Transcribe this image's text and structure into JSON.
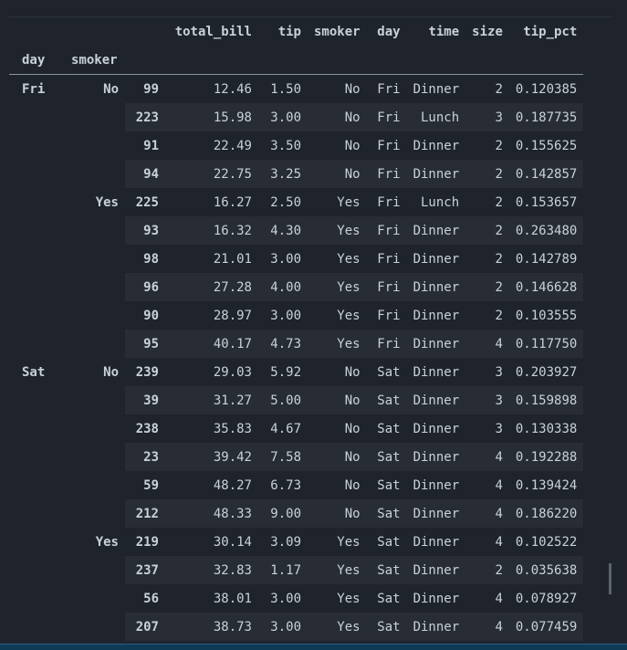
{
  "table": {
    "columns": [
      "total_bill",
      "tip",
      "smoker",
      "day",
      "time",
      "size",
      "tip_pct"
    ],
    "index_names": [
      "day",
      "smoker"
    ],
    "groups": [
      {
        "day": "Fri",
        "subgroups": [
          {
            "smoker": "No",
            "rows": [
              {
                "idx": "99",
                "total_bill": "12.46",
                "tip": "1.50",
                "smoker": "No",
                "day": "Fri",
                "time": "Dinner",
                "size": "2",
                "tip_pct": "0.120385"
              },
              {
                "idx": "223",
                "total_bill": "15.98",
                "tip": "3.00",
                "smoker": "No",
                "day": "Fri",
                "time": "Lunch",
                "size": "3",
                "tip_pct": "0.187735"
              },
              {
                "idx": "91",
                "total_bill": "22.49",
                "tip": "3.50",
                "smoker": "No",
                "day": "Fri",
                "time": "Dinner",
                "size": "2",
                "tip_pct": "0.155625"
              },
              {
                "idx": "94",
                "total_bill": "22.75",
                "tip": "3.25",
                "smoker": "No",
                "day": "Fri",
                "time": "Dinner",
                "size": "2",
                "tip_pct": "0.142857"
              }
            ]
          },
          {
            "smoker": "Yes",
            "rows": [
              {
                "idx": "225",
                "total_bill": "16.27",
                "tip": "2.50",
                "smoker": "Yes",
                "day": "Fri",
                "time": "Lunch",
                "size": "2",
                "tip_pct": "0.153657"
              },
              {
                "idx": "93",
                "total_bill": "16.32",
                "tip": "4.30",
                "smoker": "Yes",
                "day": "Fri",
                "time": "Dinner",
                "size": "2",
                "tip_pct": "0.263480"
              },
              {
                "idx": "98",
                "total_bill": "21.01",
                "tip": "3.00",
                "smoker": "Yes",
                "day": "Fri",
                "time": "Dinner",
                "size": "2",
                "tip_pct": "0.142789"
              },
              {
                "idx": "96",
                "total_bill": "27.28",
                "tip": "4.00",
                "smoker": "Yes",
                "day": "Fri",
                "time": "Dinner",
                "size": "2",
                "tip_pct": "0.146628"
              },
              {
                "idx": "90",
                "total_bill": "28.97",
                "tip": "3.00",
                "smoker": "Yes",
                "day": "Fri",
                "time": "Dinner",
                "size": "2",
                "tip_pct": "0.103555"
              },
              {
                "idx": "95",
                "total_bill": "40.17",
                "tip": "4.73",
                "smoker": "Yes",
                "day": "Fri",
                "time": "Dinner",
                "size": "4",
                "tip_pct": "0.117750"
              }
            ]
          }
        ]
      },
      {
        "day": "Sat",
        "subgroups": [
          {
            "smoker": "No",
            "rows": [
              {
                "idx": "239",
                "total_bill": "29.03",
                "tip": "5.92",
                "smoker": "No",
                "day": "Sat",
                "time": "Dinner",
                "size": "3",
                "tip_pct": "0.203927"
              },
              {
                "idx": "39",
                "total_bill": "31.27",
                "tip": "5.00",
                "smoker": "No",
                "day": "Sat",
                "time": "Dinner",
                "size": "3",
                "tip_pct": "0.159898"
              },
              {
                "idx": "238",
                "total_bill": "35.83",
                "tip": "4.67",
                "smoker": "No",
                "day": "Sat",
                "time": "Dinner",
                "size": "3",
                "tip_pct": "0.130338"
              },
              {
                "idx": "23",
                "total_bill": "39.42",
                "tip": "7.58",
                "smoker": "No",
                "day": "Sat",
                "time": "Dinner",
                "size": "4",
                "tip_pct": "0.192288"
              },
              {
                "idx": "59",
                "total_bill": "48.27",
                "tip": "6.73",
                "smoker": "No",
                "day": "Sat",
                "time": "Dinner",
                "size": "4",
                "tip_pct": "0.139424"
              },
              {
                "idx": "212",
                "total_bill": "48.33",
                "tip": "9.00",
                "smoker": "No",
                "day": "Sat",
                "time": "Dinner",
                "size": "4",
                "tip_pct": "0.186220"
              }
            ]
          },
          {
            "smoker": "Yes",
            "rows": [
              {
                "idx": "219",
                "total_bill": "30.14",
                "tip": "3.09",
                "smoker": "Yes",
                "day": "Sat",
                "time": "Dinner",
                "size": "4",
                "tip_pct": "0.102522"
              },
              {
                "idx": "237",
                "total_bill": "32.83",
                "tip": "1.17",
                "smoker": "Yes",
                "day": "Sat",
                "time": "Dinner",
                "size": "2",
                "tip_pct": "0.035638"
              },
              {
                "idx": "56",
                "total_bill": "38.01",
                "tip": "3.00",
                "smoker": "Yes",
                "day": "Sat",
                "time": "Dinner",
                "size": "4",
                "tip_pct": "0.078927"
              },
              {
                "idx": "207",
                "total_bill": "38.73",
                "tip": "3.00",
                "smoker": "Yes",
                "day": "Sat",
                "time": "Dinner",
                "size": "4",
                "tip_pct": "0.077459"
              }
            ]
          }
        ]
      }
    ]
  },
  "colors": {
    "background": "#1f242c",
    "row_stripe": "#282d35",
    "text": "#c9d1d9",
    "header_rule": "#8b949e",
    "status_bar": "#0e3a56"
  }
}
